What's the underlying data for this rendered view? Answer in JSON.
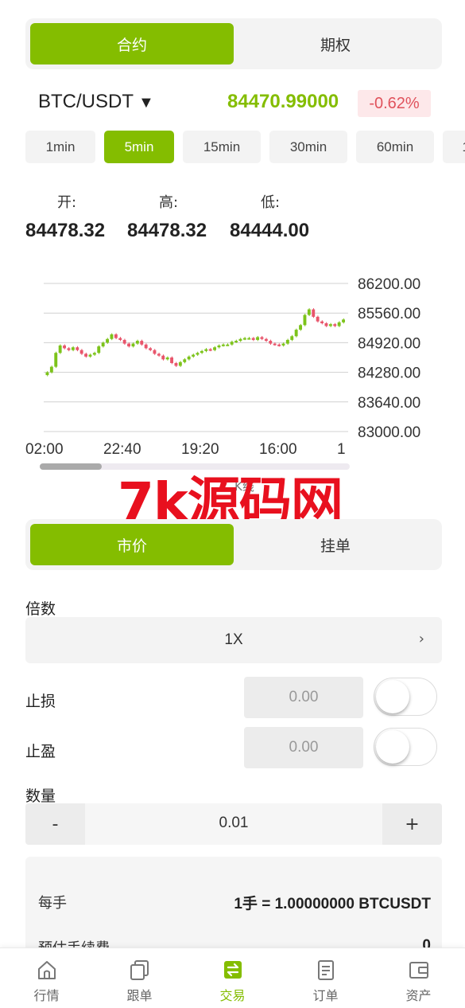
{
  "top_tabs": [
    "合约",
    "期权"
  ],
  "pair": {
    "symbol": "BTC/USDT",
    "caret": "▼",
    "price": "84470.99000",
    "change": "-0.62%"
  },
  "intervals": [
    "1min",
    "5min",
    "15min",
    "30min",
    "60min",
    "1"
  ],
  "ohl": {
    "open_label": "开:",
    "high_label": "高:",
    "low_label": "低:",
    "open": "84478.32",
    "high": "84478.32",
    "low": "84444.00"
  },
  "chart_data": {
    "type": "candlestick",
    "y_ticks": [
      "86200.00",
      "85560.00",
      "84920.00",
      "84280.00",
      "83640.00",
      "83000.00"
    ],
    "ylim": [
      83000,
      86200
    ],
    "x_ticks": [
      "02:00",
      "22:40",
      "19:20",
      "16:00",
      "1"
    ],
    "footer_label": "K线",
    "series": [
      {
        "values": [
          84280,
          84400,
          84700,
          84860,
          84800,
          84760,
          84820,
          84760,
          84680,
          84620,
          84660,
          84700,
          84840,
          84920,
          85000,
          85100,
          85020,
          84980,
          84900,
          84840,
          84900,
          84960,
          84880,
          84800,
          84760,
          84680,
          84640,
          84560,
          84600,
          84480,
          84420,
          84500,
          84560,
          84620,
          84660,
          84700,
          84740,
          84780,
          84760,
          84820,
          84860,
          84880,
          84880,
          84940,
          84960,
          85000,
          85020,
          85020,
          84980,
          85040,
          85000,
          84960,
          84900,
          84880,
          84860,
          84900,
          84980,
          85060,
          85200,
          85300,
          85520,
          85640,
          85480,
          85380,
          85340,
          85280,
          85320,
          85280,
          85360,
          85420
        ]
      }
    ]
  },
  "watermark": "7k源码网",
  "order_tabs": [
    "市价",
    "挂单"
  ],
  "form": {
    "leverage_label": "倍数",
    "leverage_value": "1X",
    "leverage_chevron": "›",
    "stop_loss_label": "止损",
    "stop_loss_value": "0.00",
    "take_profit_label": "止盈",
    "take_profit_value": "0.00",
    "quantity_label": "数量",
    "quantity_minus": "-",
    "quantity_value": "0.01",
    "quantity_plus": "+"
  },
  "info": {
    "per_lot_label": "每手",
    "per_lot_value": "1手 = 1.00000000 BTCUSDT",
    "fee_label": "预估手续费",
    "fee_value": "0"
  },
  "nav": [
    {
      "label": "行情",
      "icon": "home-icon"
    },
    {
      "label": "跟单",
      "icon": "copy-icon"
    },
    {
      "label": "交易",
      "icon": "exchange-icon"
    },
    {
      "label": "订单",
      "icon": "order-icon"
    },
    {
      "label": "资产",
      "icon": "wallet-icon"
    }
  ]
}
